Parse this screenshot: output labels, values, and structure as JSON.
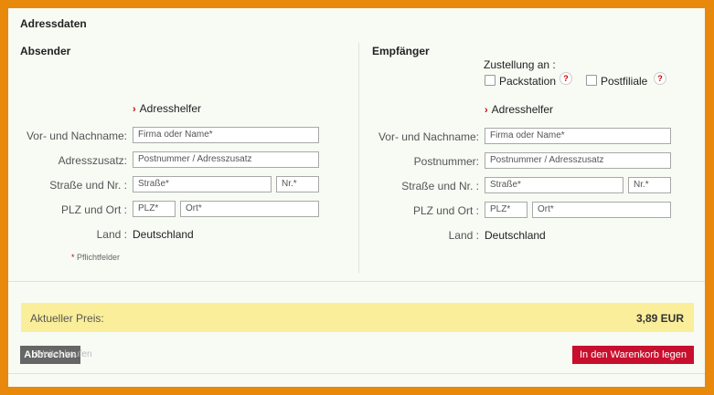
{
  "title": "Adressdaten",
  "sender": {
    "heading": "Absender",
    "helper": "Adresshelfer",
    "labels": {
      "name": "Vor- und Nachname:",
      "extra": "Adresszusatz:",
      "street": "Straße und Nr. :",
      "city": "PLZ und Ort :",
      "country": "Land :"
    },
    "placeholders": {
      "name": "Firma oder Name*",
      "extra": "Postnummer / Adresszusatz",
      "street": "Straße*",
      "nr": "Nr.*",
      "plz": "PLZ*",
      "ort": "Ort*"
    },
    "country": "Deutschland",
    "required_note": "Pflichtfelder",
    "required_star": "*"
  },
  "recipient": {
    "heading": "Empfänger",
    "delivery_label": "Zustellung an :",
    "options": [
      "Packstation",
      "Postfiliale"
    ],
    "help_icon": "?",
    "helper": "Adresshelfer",
    "labels": {
      "name": "Vor- und Nachname:",
      "extra": "Postnummer:",
      "street": "Straße und Nr. :",
      "city": "PLZ und Ort :",
      "country": "Land :"
    },
    "placeholders": {
      "name": "Firma oder Name*",
      "extra": "Postnummer / Adresszusatz",
      "street": "Straße*",
      "nr": "Nr.*",
      "plz": "PLZ*",
      "ort": "Ort*"
    },
    "country": "Deutschland"
  },
  "price": {
    "label": "Aktueller Preis:",
    "value": "3,89 EUR"
  },
  "buttons": {
    "cancel": "Abbrechen",
    "ghost": "Weiter kaufen",
    "cart": "In den Warenkorb legen"
  },
  "colors": {
    "frame": "#e8890c",
    "price_bar": "#fbee9a",
    "cart_button": "#c8102e",
    "cancel_button": "#666666"
  }
}
